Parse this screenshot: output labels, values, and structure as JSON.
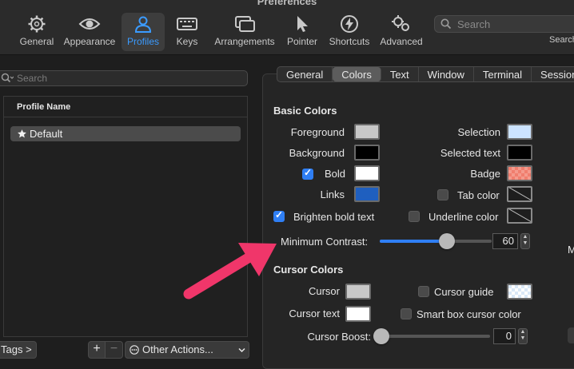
{
  "window": {
    "title": "Preferences"
  },
  "toolbar": {
    "items": [
      {
        "label": "General",
        "icon": "gear-icon"
      },
      {
        "label": "Appearance",
        "icon": "eye-icon"
      },
      {
        "label": "Profiles",
        "icon": "person-icon",
        "active": true
      },
      {
        "label": "Keys",
        "icon": "keyboard-icon"
      },
      {
        "label": "Arrangements",
        "icon": "windows-icon"
      },
      {
        "label": "Pointer",
        "icon": "pointer-icon"
      },
      {
        "label": "Shortcuts",
        "icon": "bolt-icon"
      },
      {
        "label": "Advanced",
        "icon": "gears-icon"
      }
    ],
    "search_placeholder": "Search",
    "search_label": "Search"
  },
  "left": {
    "search_placeholder": "Search",
    "column_header": "Profile Name",
    "profiles": [
      {
        "name": "Default",
        "starred": true,
        "selected": true
      }
    ],
    "tags_button": "Tags >",
    "add_button": "+",
    "remove_button": "−",
    "other_actions": "Other Actions..."
  },
  "tabs": [
    "General",
    "Colors",
    "Text",
    "Window",
    "Terminal",
    "Session"
  ],
  "active_tab": "Colors",
  "basic_colors": {
    "title": "Basic Colors",
    "foreground": {
      "label": "Foreground",
      "color": "#c8c8c8"
    },
    "background": {
      "label": "Background",
      "color": "#000000"
    },
    "bold": {
      "label": "Bold",
      "checked": true,
      "color": "#ffffff"
    },
    "links": {
      "label": "Links",
      "color": "#1f5fbf"
    },
    "selection": {
      "label": "Selection",
      "color": "#cce3ff"
    },
    "selected_text": {
      "label": "Selected text",
      "color": "#000000"
    },
    "badge": {
      "label": "Badge",
      "color": "#f07e6e"
    },
    "tab_color": {
      "label": "Tab color",
      "checked": false
    },
    "underline_color": {
      "label": "Underline color",
      "checked": false
    },
    "brighten_bold": {
      "label": "Brighten bold text",
      "checked": true
    },
    "minimum_contrast": {
      "label": "Minimum Contrast:",
      "value": "60",
      "fraction": 0.6
    }
  },
  "cursor_colors": {
    "title": "Cursor Colors",
    "cursor": {
      "label": "Cursor",
      "color": "#c8c8c8"
    },
    "cursor_text": {
      "label": "Cursor text",
      "color": "#ffffff"
    },
    "cursor_guide": {
      "label": "Cursor guide",
      "checked": false
    },
    "smart_box": {
      "label": "Smart box cursor color",
      "checked": false
    },
    "cursor_boost": {
      "label": "Cursor Boost:",
      "value": "0",
      "fraction": 0
    }
  },
  "right_edge_text": "M",
  "colors": {
    "accent": "#2f7ff5",
    "arrow": "#f0366a",
    "active_toolbar": "#3b9bff"
  }
}
